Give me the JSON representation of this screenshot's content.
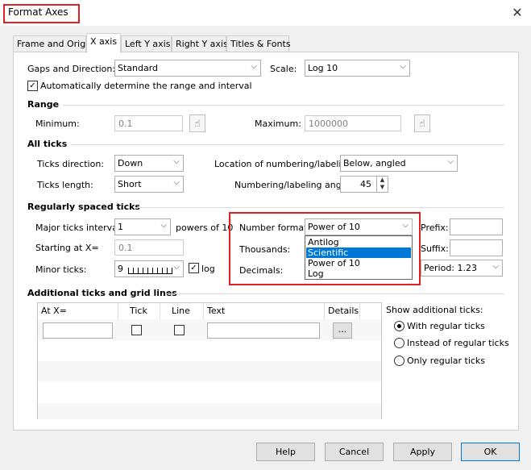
{
  "window": {
    "title": "Format Axes",
    "close_glyph": "✕"
  },
  "tabs": [
    "Frame and Origin",
    "X axis",
    "Left Y axis",
    "Right Y axis",
    "Titles & Fonts"
  ],
  "top": {
    "gaps_label": "Gaps and Direction:",
    "gaps_value": "Standard",
    "scale_label": "Scale:",
    "scale_value": "Log 10",
    "auto_range_label": "Automatically determine the range and interval",
    "auto_range_checked": true
  },
  "range": {
    "heading": "Range",
    "min_label": "Minimum:",
    "min_value": "0.1",
    "max_label": "Maximum:",
    "max_value": "1000000"
  },
  "all_ticks": {
    "heading": "All ticks",
    "direction_label": "Ticks direction:",
    "direction_value": "Down",
    "length_label": "Ticks length:",
    "length_value": "Short",
    "location_label": "Location of numbering/labeling:",
    "location_value": "Below, angled",
    "angle_label": "Numbering/labeling angle:",
    "angle_value": "45"
  },
  "regular": {
    "heading": "Regularly spaced ticks",
    "major_label": "Major ticks interval:",
    "major_value": "1",
    "powers_label": "powers of 10",
    "start_label": "Starting at X=",
    "start_value": "0.1",
    "minor_label": "Minor ticks:",
    "minor_value": "9",
    "log_label": "log",
    "log_checked": true,
    "number_format_label": "Number format:",
    "number_format_value": "Power of 10",
    "number_format_options": [
      "Antilog",
      "Scientific",
      "Power of 10",
      "Log"
    ],
    "number_format_highlighted": "Scientific",
    "thousands_label": "Thousands:",
    "decimals_label": "Decimals:",
    "prefix_label": "Prefix:",
    "suffix_label": "Suffix:",
    "period_value": "Period: 1.23"
  },
  "additional": {
    "heading": "Additional ticks and grid lines",
    "columns": [
      "At X=",
      "Tick",
      "Line",
      "Text",
      "Details"
    ],
    "details_button": "...",
    "show_label": "Show additional ticks:",
    "options": [
      "With regular ticks",
      "Instead of regular ticks",
      "Only regular ticks"
    ],
    "selected": "With regular ticks"
  },
  "buttons": {
    "help": "Help",
    "cancel": "Cancel",
    "apply": "Apply",
    "ok": "OK"
  },
  "icons": {
    "hand": "hand-pointer-icon",
    "check": "checkmark-icon",
    "chevron": "chevron-down-icon"
  },
  "colors": {
    "highlight_border": "#e02020",
    "selection": "#0078d7"
  }
}
